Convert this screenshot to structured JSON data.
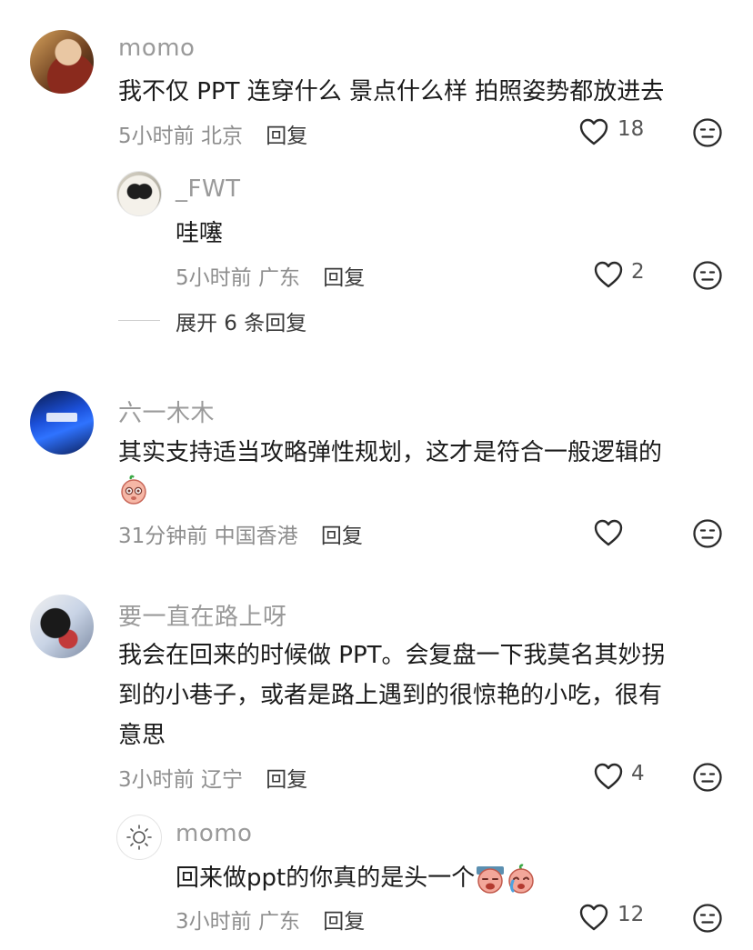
{
  "comments": [
    {
      "username": "momo",
      "text": "我不仅 PPT 连穿什么 景点什么样 拍照姿势都放进去",
      "time": "5小时前",
      "location": "北京",
      "reply_label": "回复",
      "likes": "18",
      "replies": [
        {
          "username": "_FWT",
          "text": "哇噻",
          "time": "5小时前",
          "location": "广东",
          "reply_label": "回复",
          "likes": "2"
        }
      ],
      "expand_label": "展开 6 条回复"
    },
    {
      "username": "六一木木",
      "text_line1": "其实支持适当攻略弹性规划，这才是符合一般逻辑的",
      "time": "31分钟前",
      "location": "中国香港",
      "reply_label": "回复",
      "likes": ""
    },
    {
      "username": "要一直在路上呀",
      "text_line1": "我会在回来的时候做 PPT。会复盘一下我莫名其妙拐",
      "text_line2": "到的小巷子，或者是路上遇到的很惊艳的小吃，很有",
      "text_line3": "意思",
      "time": "3小时前",
      "location": "辽宁",
      "reply_label": "回复",
      "likes": "4",
      "replies": [
        {
          "username": "momo",
          "text": "回来做ppt的你真的是头一个",
          "time": "3小时前",
          "location": "广东",
          "reply_label": "回复",
          "likes": "12"
        }
      ]
    }
  ],
  "icons": {
    "like": "heart-outline-icon",
    "dislike": "meh-face-icon"
  }
}
